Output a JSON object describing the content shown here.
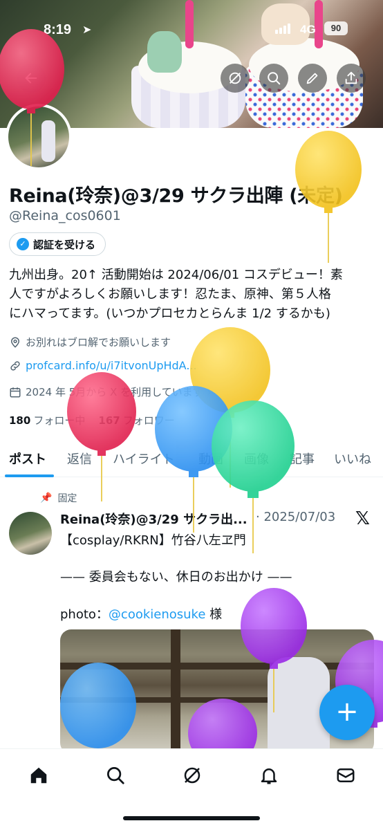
{
  "status_bar": {
    "time": "8:19",
    "network": "4G",
    "battery": "90"
  },
  "header": {
    "back_icon": "arrow-left-icon",
    "action_icons": [
      "grok-icon",
      "search-icon",
      "edit-icon",
      "share-icon"
    ]
  },
  "profile": {
    "name": "Reina(玲奈)@3/29 サクラ出陣 (未定)",
    "handle": "@Reina_cos0601",
    "verify_label": "認証を受ける",
    "bio_lines": [
      "九州出身。20↑ 活動開始は 2024/06/01 コスデビュー！素",
      "人ですがよろしくお願いします！忍たま、原神、第５人格",
      "にハマってます。(いつかプロセカとらんま 1/2 するかも)"
    ],
    "location": "お別れはブロ解でお願いします",
    "link": "profcard.info/u/i7itvonUpHdA...",
    "joined": "2024 年 5月から X を利用しています",
    "following_count": "180",
    "following_label": "フォロー中",
    "followers_count": "167",
    "followers_label": "フォロワー"
  },
  "tabs": [
    {
      "label": "ポスト",
      "active": true
    },
    {
      "label": "返信"
    },
    {
      "label": "ハイライト"
    },
    {
      "label": "動画"
    },
    {
      "label": "画像"
    },
    {
      "label": "記事"
    },
    {
      "label": "いいね"
    }
  ],
  "pinned_post": {
    "pinned_label": "固定",
    "author": "Reina(玲奈)@3/29 サクラ出...",
    "date": "· 2025/07/03",
    "line1": "【cosplay/RKRN】竹谷八左ヱ門",
    "line2": "—— 委員会もない、休日のお出かけ ——",
    "line3_prefix": "photo：",
    "line3_mention": "@cookienosuke",
    "line3_suffix": " 様"
  },
  "fab_label": "+",
  "bottom_nav": [
    "home-icon",
    "search-icon",
    "grok-icon",
    "notifications-icon",
    "messages-icon"
  ],
  "colors": {
    "accent": "#1d9bf0",
    "text": "#0f1419",
    "muted": "#536471"
  }
}
